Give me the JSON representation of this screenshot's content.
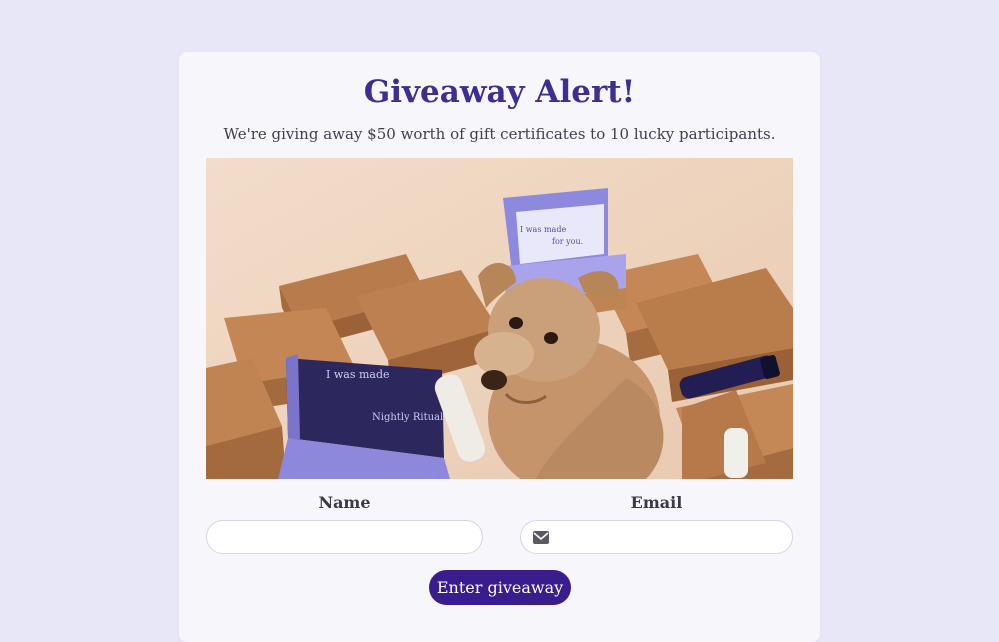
{
  "theme": {
    "page_background": "#e8e7f7",
    "card_background": "#f6f6fb",
    "title_color": "#3c2f8f",
    "button_color": "#3a1d8c"
  },
  "giveaway": {
    "title": "Giveaway Alert!",
    "description": "We're giving away $50 worth of gift certificates to 10 lucky participants."
  },
  "photo": {
    "box_text_1": "I was made",
    "box_text_2": "for you.",
    "box_text_3": "I was made",
    "box_text_4": "Nightly Ritual"
  },
  "form": {
    "name_label": "Name",
    "name_value": "",
    "email_label": "Email",
    "email_value": "",
    "email_icon": "envelope-icon",
    "submit_label": "Enter giveaway"
  }
}
